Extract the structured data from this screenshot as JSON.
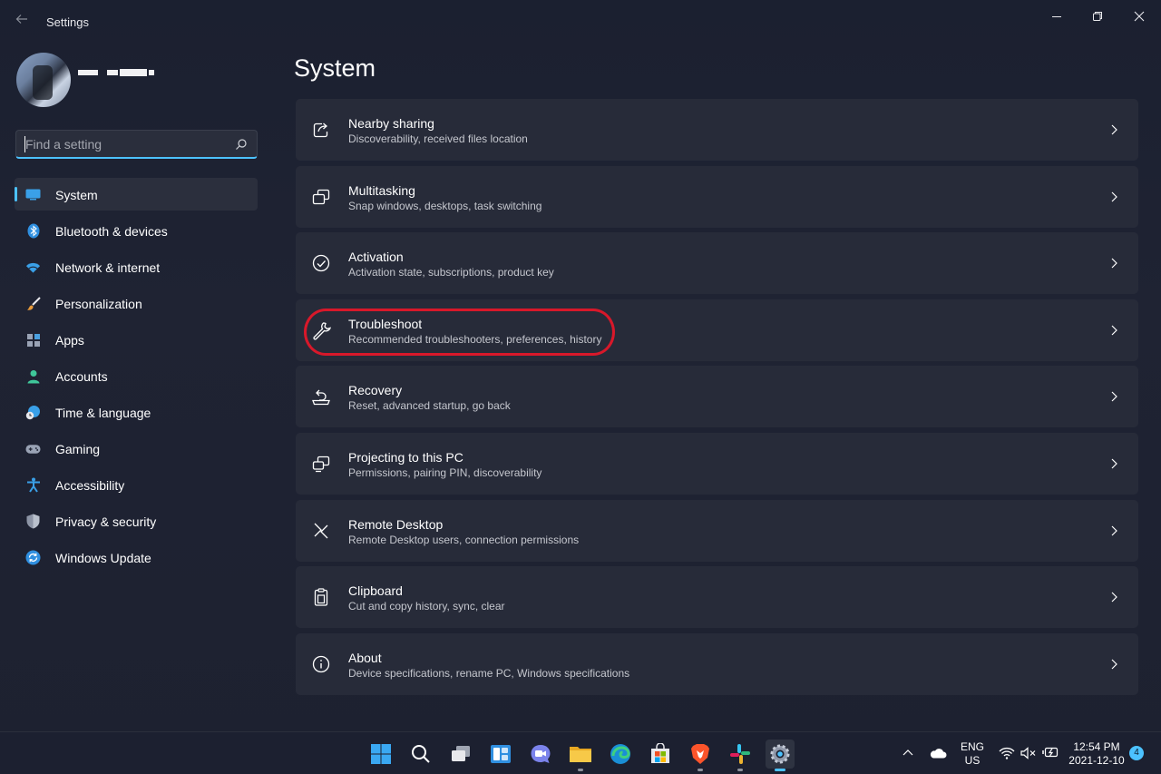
{
  "window": {
    "title": "Settings",
    "back_icon": "back-arrow-icon",
    "controls": [
      "minimize-icon",
      "restore-icon",
      "close-icon"
    ]
  },
  "user": {
    "avatar": "avatar-image",
    "name_redacted": true
  },
  "search": {
    "placeholder": "Find a setting",
    "value": "",
    "icon": "search-icon"
  },
  "sidebar": {
    "items": [
      {
        "label": "System",
        "icon": "system-icon",
        "active": true
      },
      {
        "label": "Bluetooth & devices",
        "icon": "bluetooth-icon",
        "active": false
      },
      {
        "label": "Network & internet",
        "icon": "wifi-icon",
        "active": false
      },
      {
        "label": "Personalization",
        "icon": "brush-icon",
        "active": false
      },
      {
        "label": "Apps",
        "icon": "apps-icon",
        "active": false
      },
      {
        "label": "Accounts",
        "icon": "person-icon",
        "active": false
      },
      {
        "label": "Time & language",
        "icon": "clock-globe-icon",
        "active": false
      },
      {
        "label": "Gaming",
        "icon": "gamepad-icon",
        "active": false
      },
      {
        "label": "Accessibility",
        "icon": "accessibility-icon",
        "active": false
      },
      {
        "label": "Privacy & security",
        "icon": "shield-icon",
        "active": false
      },
      {
        "label": "Windows Update",
        "icon": "update-icon",
        "active": false
      }
    ]
  },
  "main": {
    "title": "System",
    "cards": [
      {
        "title": "Nearby sharing",
        "subtitle": "Discoverability, received files location",
        "icon": "share-icon"
      },
      {
        "title": "Multitasking",
        "subtitle": "Snap windows, desktops, task switching",
        "icon": "multitasking-icon"
      },
      {
        "title": "Activation",
        "subtitle": "Activation state, subscriptions, product key",
        "icon": "check-circle-icon"
      },
      {
        "title": "Troubleshoot",
        "subtitle": "Recommended troubleshooters, preferences, history",
        "icon": "wrench-icon",
        "highlighted": true
      },
      {
        "title": "Recovery",
        "subtitle": "Reset, advanced startup, go back",
        "icon": "recovery-icon"
      },
      {
        "title": "Projecting to this PC",
        "subtitle": "Permissions, pairing PIN, discoverability",
        "icon": "projecting-icon"
      },
      {
        "title": "Remote Desktop",
        "subtitle": "Remote Desktop users, connection permissions",
        "icon": "remote-desktop-icon"
      },
      {
        "title": "Clipboard",
        "subtitle": "Cut and copy history, sync, clear",
        "icon": "clipboard-icon"
      },
      {
        "title": "About",
        "subtitle": "Device specifications, rename PC, Windows specifications",
        "icon": "info-icon"
      }
    ],
    "annotation_color": "#d8182a"
  },
  "taskbar": {
    "apps": [
      "start-icon",
      "search-icon",
      "task-view-icon",
      "widgets-icon",
      "teams-chat-icon",
      "file-explorer-icon",
      "edge-icon",
      "store-icon",
      "brave-icon",
      "slack-icon",
      "settings-icon"
    ],
    "tray": {
      "language_line1": "ENG",
      "language_line2": "US",
      "time": "12:54 PM",
      "date": "2021-12-10",
      "notifications": "4"
    }
  },
  "colors": {
    "accent": "#4cc2ff",
    "background": "#1f2333",
    "card": "#272b39"
  }
}
